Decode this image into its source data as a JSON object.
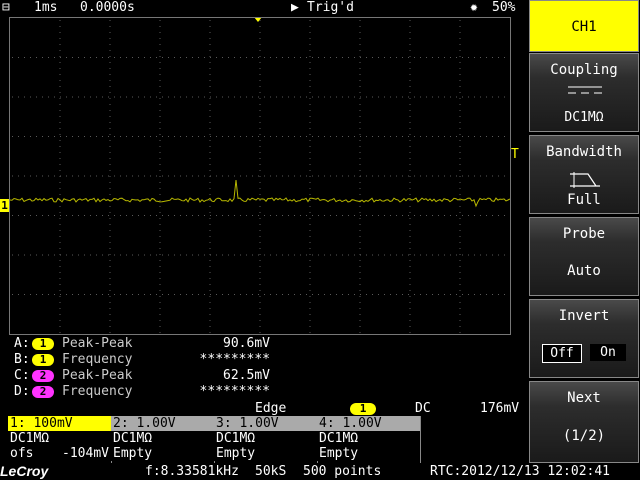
{
  "topbar": {
    "timebase": "1ms",
    "delay": "0.0000s",
    "run_state": "Trig'd",
    "brightness": "50%"
  },
  "channel_marker": "1",
  "trigger_marker": "T",
  "measurements": [
    {
      "slot": "A:",
      "channel": "1",
      "name": "Peak-Peak",
      "value": "90.6mV",
      "color": "#ffff00"
    },
    {
      "slot": "B:",
      "channel": "1",
      "name": "Frequency",
      "value": "*********",
      "color": "#ffff00"
    },
    {
      "slot": "C:",
      "channel": "2",
      "name": "Peak-Peak",
      "value": "62.5mV",
      "color": "#ff33ff"
    },
    {
      "slot": "D:",
      "channel": "2",
      "name": "Frequency",
      "value": "*********",
      "color": "#ff33ff"
    }
  ],
  "trigger": {
    "type": "Edge",
    "source": "1",
    "coupling": "DC",
    "level": "176mV"
  },
  "channels": [
    {
      "header": "1: 100mV",
      "line1": "DC1MΩ",
      "line2_label": "ofs",
      "line2_value": "-104mV",
      "active": true
    },
    {
      "header": "2: 1.00V",
      "line1": "DC1MΩ",
      "line2_label": "Empty",
      "line2_value": "",
      "active": false
    },
    {
      "header": "3: 1.00V",
      "line1": "DC1MΩ",
      "line2_label": "Empty",
      "line2_value": "",
      "active": false
    },
    {
      "header": "4: 1.00V",
      "line1": "DC1MΩ",
      "line2_label": "Empty",
      "line2_value": "",
      "active": false
    }
  ],
  "status": {
    "logo": "LeCroy",
    "frequency": "f:8.33581kHz",
    "sample_rate": "50kS",
    "points": "500 points",
    "rtc": "RTC:2012/12/13 12:02:41"
  },
  "menu": {
    "title": "CH1",
    "coupling_label": "Coupling",
    "coupling_value": "DC1MΩ",
    "bandwidth_label": "Bandwidth",
    "bandwidth_value": "Full",
    "probe_label": "Probe",
    "probe_value": "Auto",
    "invert_label": "Invert",
    "invert_off": "Off",
    "invert_on": "On",
    "next_label": "Next",
    "next_value": "(1/2)"
  },
  "colors": {
    "ch1": "#ffff00",
    "ch2": "#ff33ff",
    "trace": "#b8b800",
    "grid": "#5a5a5a"
  }
}
